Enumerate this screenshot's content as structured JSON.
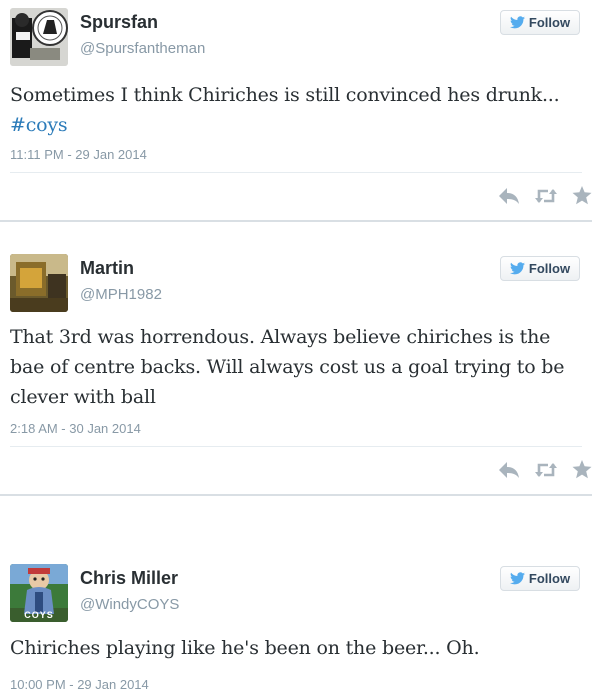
{
  "tweets": [
    {
      "name": "Spursfan",
      "handle": "@Spursfantheman",
      "follow_label": "Follow",
      "text": "Sometimes I think Chiriches is still convinced hes drunk...",
      "hashtag": "#coys",
      "timestamp": "11:11 PM - 29 Jan 2014",
      "avatar_icon": "spurs-cockerel-avatar"
    },
    {
      "name": "Martin",
      "handle": "@MPH1982",
      "follow_label": "Follow",
      "text_line1": "That 3rd was horrendous.  Always believe chiriches is the",
      "text_line2": "bae of centre backs. Will always cost us a goal trying to be",
      "text_line3": "clever with ball",
      "timestamp": "2:18 AM - 30 Jan 2014",
      "avatar_icon": "room-photo-avatar"
    },
    {
      "name": "Chris Miller",
      "handle": "@WindyCOYS",
      "follow_label": "Follow",
      "text": "Chiriches playing like he's been on the beer... Oh.",
      "timestamp": "10:00 PM - 29 Jan 2014",
      "avatar_icon": "cartoon-character-avatar",
      "avatar_caption": "COYS"
    }
  ],
  "icons": {
    "reply": "reply-icon",
    "retweet": "retweet-icon",
    "favorite": "star-icon",
    "bird": "twitter-bird-icon"
  },
  "colors": {
    "follow_text": "#33495f",
    "bird": "#55acee",
    "hashtag": "#2b7bb9",
    "meta": "#8899a6"
  }
}
